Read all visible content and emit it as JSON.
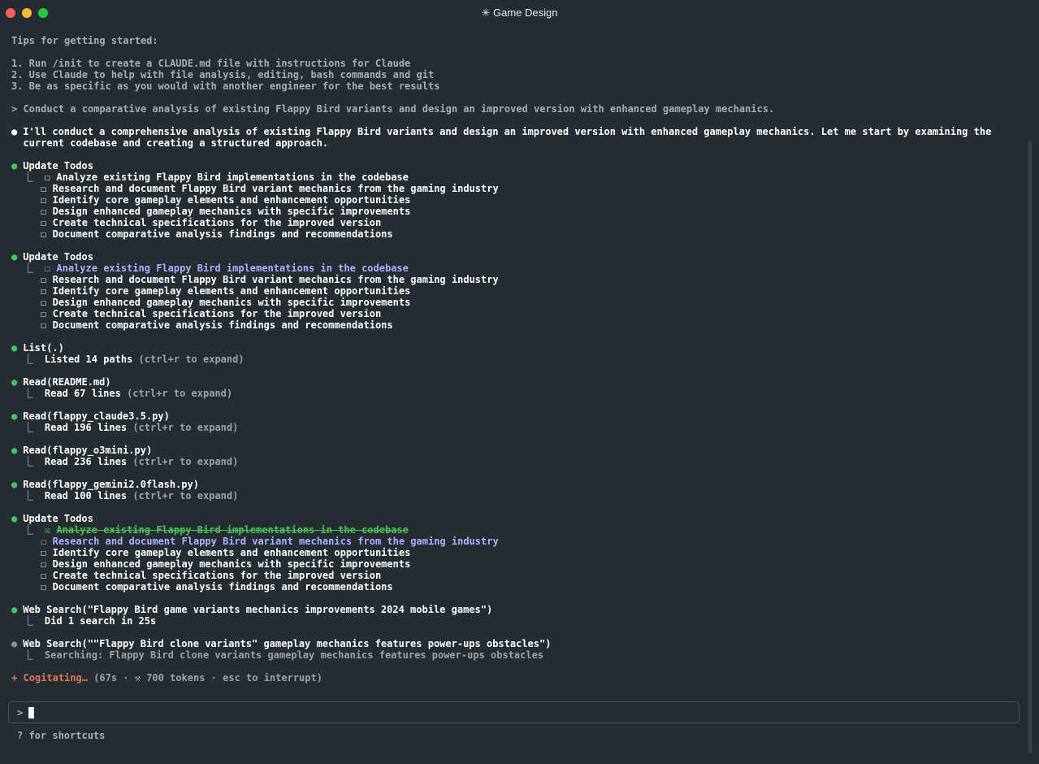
{
  "window": {
    "title": "✳ Game Design"
  },
  "tips": {
    "heading": "Tips for getting started:",
    "items": [
      "1. Run /init to create a CLAUDE.md file with instructions for Claude",
      "2. Use Claude to help with file analysis, editing, bash commands and git",
      "3. Be as specific as you would with another engineer for the best results"
    ]
  },
  "user_prompt": "> Conduct a comparative analysis of existing Flappy Bird variants and design an improved version with enhanced gameplay mechanics.",
  "assistant_message": {
    "line1": "I'll conduct a comprehensive analysis of existing Flappy Bird variants and design an improved version with enhanced gameplay mechanics. Let me start by examining the",
    "line2": "current codebase and creating a structured approach."
  },
  "todos": [
    "Analyze existing Flappy Bird implementations in the codebase",
    "Research and document Flappy Bird variant mechanics from the gaming industry",
    "Identify core gameplay elements and enhancement opportunities",
    "Design enhanced gameplay mechanics with specific improvements",
    "Create technical specifications for the improved version",
    "Document comparative analysis findings and recommendations"
  ],
  "labels": {
    "update_todos": "Update Todos",
    "expand_hint": "(ctrl+r to expand)",
    "unchecked_box": "☐",
    "checked_box": "☒"
  },
  "tools": {
    "list": {
      "call": "List(.)",
      "result": "Listed 14 paths"
    },
    "read1": {
      "call": "Read(README.md)",
      "result": "Read 67 lines"
    },
    "read2": {
      "call": "Read(flappy_claude3.5.py)",
      "result": "Read 196 lines"
    },
    "read3": {
      "call": "Read(flappy_o3mini.py)",
      "result": "Read 236 lines"
    },
    "read4": {
      "call": "Read(flappy_gemini2.0flash.py)",
      "result": "Read 100 lines"
    },
    "search1": {
      "call": "Web Search(\"Flappy Bird game variants mechanics improvements 2024 mobile games\")",
      "result": "Did 1 search in 25s"
    },
    "search2": {
      "call": "Web Search(\"\"Flappy Bird clone variants\" gameplay mechanics features power-ups obstacles\")",
      "result": "Searching: Flappy Bird clone variants gameplay mechanics features power-ups obstacles"
    }
  },
  "status": {
    "spinner": "+",
    "label": "Cogitating…",
    "detail": "(67s · ⚒ 700 tokens · esc to interrupt)"
  },
  "input": {
    "prompt": ">",
    "hint": "? for shortcuts"
  },
  "colors": {
    "background": "#252d33",
    "success": "#4cc35a",
    "active_todo": "#aab2ff",
    "status_accent": "#e07856"
  }
}
